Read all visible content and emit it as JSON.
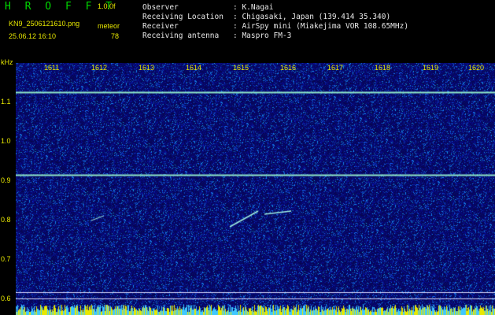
{
  "header": {
    "brand": "H R O F F T",
    "version": "1.0.0f",
    "filename": "KN9_2506121610.png",
    "datetime": "25.06.12 16:10",
    "meteor_label": "meteor",
    "meteor_count": "78"
  },
  "info": [
    {
      "key": "Observer",
      "value": ": K.Nagai"
    },
    {
      "key": "Receiving Location",
      "value": ": Chigasaki, Japan (139.414 35.340)"
    },
    {
      "key": "Receiver",
      "value": ": AirSpy mini (Miakejima VOR 108.65MHz)"
    },
    {
      "key": "Receiving antenna",
      "value": ": Maspro FM-3"
    }
  ],
  "spectrogram": {
    "unit": "kHz",
    "y_ticks": [
      "1.1",
      "1.0",
      "0.9",
      "0.8",
      "0.7",
      "0.6"
    ],
    "x_ticks": [
      "1611",
      "1612",
      "1613",
      "1614",
      "1615",
      "1616",
      "1617",
      "1618",
      "1619",
      "1620"
    ],
    "signal_lines_khz": [
      1.11,
      0.905
    ],
    "colors": {
      "background": "#000000",
      "label": "#e8e800",
      "brand": "#00d800",
      "info_text": "#e8e8e8",
      "noise_base": "#0c0c70",
      "signal": "#a8f0c0",
      "bottom_bar": "#e8e800"
    }
  }
}
